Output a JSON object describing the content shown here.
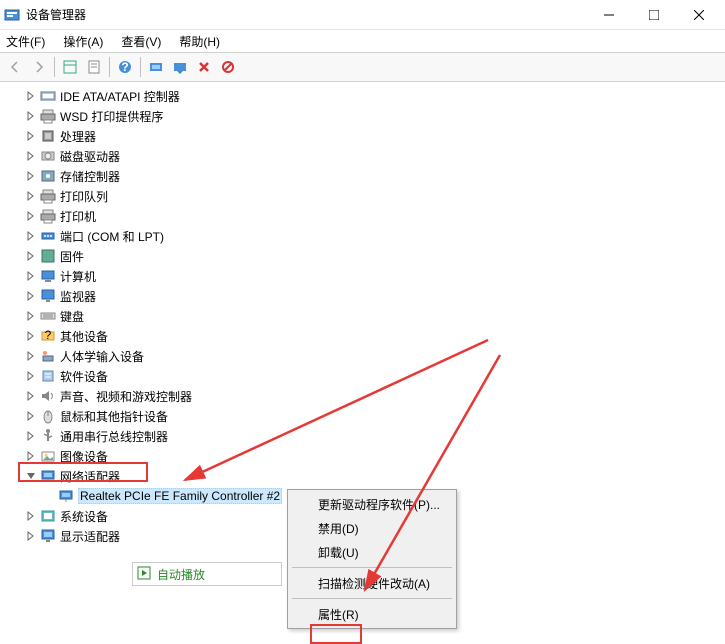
{
  "window": {
    "title": "设备管理器"
  },
  "menubar": {
    "file": "文件(F)",
    "action": "操作(A)",
    "view": "查看(V)",
    "help": "帮助(H)"
  },
  "tree": {
    "items": [
      {
        "label": "IDE ATA/ATAPI 控制器",
        "icon": "ide"
      },
      {
        "label": "WSD 打印提供程序",
        "icon": "printer"
      },
      {
        "label": "处理器",
        "icon": "cpu"
      },
      {
        "label": "磁盘驱动器",
        "icon": "disk"
      },
      {
        "label": "存储控制器",
        "icon": "storage"
      },
      {
        "label": "打印队列",
        "icon": "printer"
      },
      {
        "label": "打印机",
        "icon": "printer"
      },
      {
        "label": "端口 (COM 和 LPT)",
        "icon": "port"
      },
      {
        "label": "固件",
        "icon": "firmware"
      },
      {
        "label": "计算机",
        "icon": "computer"
      },
      {
        "label": "监视器",
        "icon": "monitor"
      },
      {
        "label": "键盘",
        "icon": "keyboard"
      },
      {
        "label": "其他设备",
        "icon": "other"
      },
      {
        "label": "人体学输入设备",
        "icon": "hid"
      },
      {
        "label": "软件设备",
        "icon": "software"
      },
      {
        "label": "声音、视频和游戏控制器",
        "icon": "audio"
      },
      {
        "label": "鼠标和其他指针设备",
        "icon": "mouse"
      },
      {
        "label": "通用串行总线控制器",
        "icon": "usb"
      },
      {
        "label": "图像设备",
        "icon": "image"
      }
    ],
    "network_adapter": "网络适配器",
    "selected_device": "Realtek PCIe FE Family Controller #2",
    "after": [
      {
        "label": "系统设备",
        "icon": "system"
      },
      {
        "label": "显示适配器",
        "icon": "display"
      }
    ]
  },
  "contextmenu": {
    "update_driver": "更新驱动程序软件(P)...",
    "disable": "禁用(D)",
    "uninstall": "卸载(U)",
    "scan": "扫描检测硬件改动(A)",
    "properties": "属性(R)"
  },
  "autoplay": "自动播放"
}
